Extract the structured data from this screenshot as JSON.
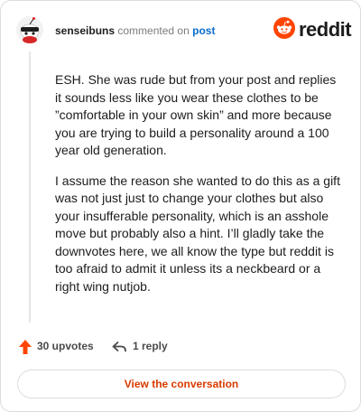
{
  "header": {
    "username": "senseibuns",
    "action_text": "commented on",
    "post_link": "post",
    "brand_name": "reddit",
    "brand_color": "#ff4500"
  },
  "comment": {
    "paragraphs": [
      "ESH. She was rude but from your post and replies it sounds less like you wear these clothes to be ”comfortable in your own skin” and more because you are trying to build a personality around a 100 year old generation.",
      "I assume the reason she wanted to do this as a gift was not just just to change your clothes but also your insufferable personality, which is an asshole move but probably also a hint. I’ll gladly take the downvotes here, we all know the type but reddit is too afraid to admit it unless its a neckbeard or a right wing nutjob."
    ]
  },
  "actions": {
    "upvotes": "30 upvotes",
    "replies": "1 reply",
    "upvote_icon": "upvote-arrow",
    "reply_icon": "reply-arrow",
    "accent_color": "#ff4500"
  },
  "cta": {
    "label": "View the conversation",
    "color": "#d93a00"
  }
}
